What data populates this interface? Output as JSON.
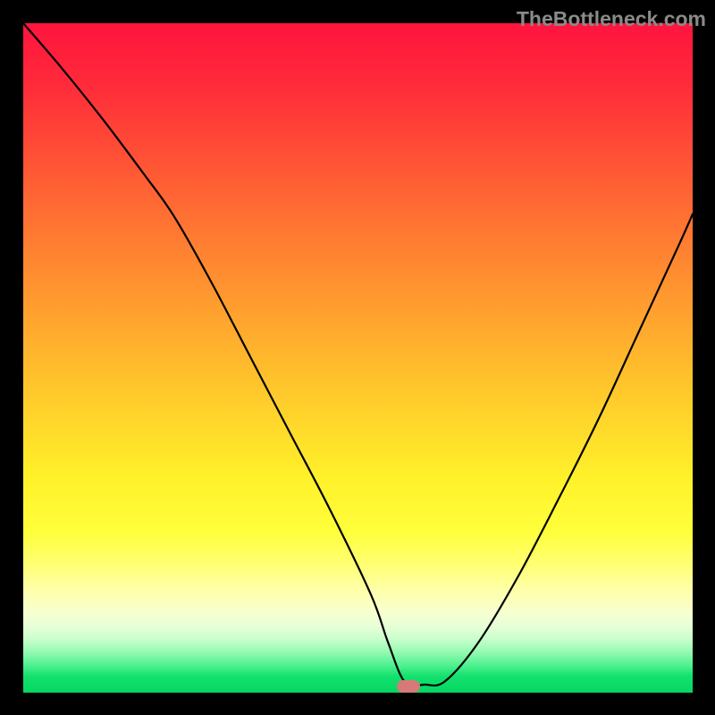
{
  "watermark": "TheBottleneck.com",
  "marker": {
    "x_frac": 0.575,
    "y_frac": 0.992
  },
  "chart_data": {
    "type": "line",
    "title": "",
    "xlabel": "",
    "ylabel": "",
    "xlim": [
      0,
      1
    ],
    "ylim": [
      0,
      1
    ],
    "series": [
      {
        "name": "curve",
        "x": [
          0.0,
          0.06,
          0.12,
          0.18,
          0.225,
          0.28,
          0.34,
          0.4,
          0.46,
          0.52,
          0.545,
          0.57,
          0.6,
          0.63,
          0.68,
          0.74,
          0.8,
          0.86,
          0.92,
          0.98,
          1.0
        ],
        "y": [
          1.0,
          0.93,
          0.855,
          0.775,
          0.712,
          0.615,
          0.5,
          0.385,
          0.27,
          0.145,
          0.075,
          0.016,
          0.012,
          0.017,
          0.075,
          0.175,
          0.29,
          0.41,
          0.54,
          0.67,
          0.715
        ]
      }
    ],
    "marker": {
      "x": 0.575,
      "y": 0.008
    },
    "gradient_stops": [
      {
        "pos": 0.0,
        "color": "#ff143e"
      },
      {
        "pos": 0.48,
        "color": "#ffd22b"
      },
      {
        "pos": 0.76,
        "color": "#ffff3b"
      },
      {
        "pos": 0.92,
        "color": "#c9ffcc"
      },
      {
        "pos": 1.0,
        "color": "#05d561"
      }
    ]
  }
}
